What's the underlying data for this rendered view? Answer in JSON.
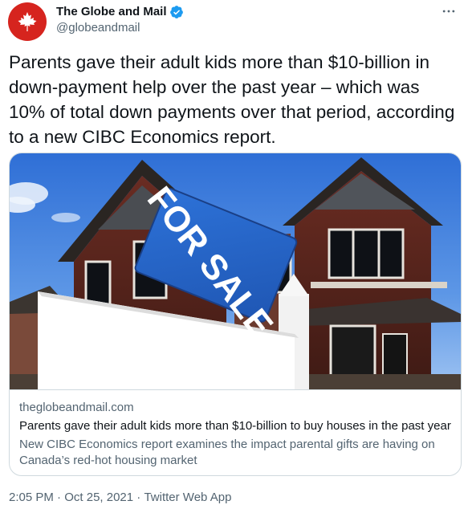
{
  "author": {
    "display_name": "The Globe and Mail",
    "handle": "@globeandmail",
    "avatar_icon": "maple-leaf-icon",
    "verified_icon": "verified-badge-icon",
    "brand_color": "#d6241e",
    "verified_color": "#1d9bf0"
  },
  "tweet": {
    "text": "Parents gave their adult kids more than $10-billion in down-payment help over the past year – which was 10% of total down payments over that period, according to a new CIBC Economics report."
  },
  "card": {
    "image_sign_text": "FOR SALE",
    "domain": "theglobeandmail.com",
    "title": "Parents gave their adult kids more than $10-billion to buy houses in the past year",
    "description": "New CIBC Economics report examines the impact parental gifts are having on Canada’s red-hot housing market"
  },
  "meta": {
    "time": "2:05 PM",
    "separator": " · ",
    "date": "Oct 25, 2021",
    "source": "Twitter Web App"
  },
  "colors": {
    "text_primary": "#0f1419",
    "text_secondary": "#536471",
    "border": "#cfd9de"
  }
}
